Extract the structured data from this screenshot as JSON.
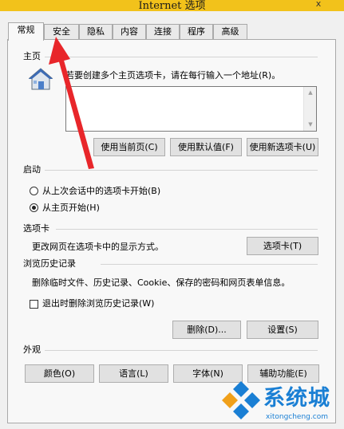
{
  "window": {
    "title": "Internet 选项",
    "close_glyph": "x"
  },
  "tabs": [
    "常规",
    "安全",
    "隐私",
    "内容",
    "连接",
    "程序",
    "高级"
  ],
  "homepage": {
    "header": "主页",
    "instruction": "若要创建多个主页选项卡，请在每行输入一个地址(R)。",
    "address_value": "",
    "buttons": {
      "use_current": "使用当前页(C)",
      "use_default": "使用默认值(F)",
      "use_new_tab": "使用新选项卡(U)"
    }
  },
  "startup": {
    "header": "启动",
    "option_last_session": "从上次会话中的选项卡开始(B)",
    "option_homepage": "从主页开始(H)",
    "selected": "homepage"
  },
  "tabs_section": {
    "header": "选项卡",
    "description": "更改网页在选项卡中的显示方式。",
    "button": "选项卡(T)"
  },
  "history": {
    "header": "浏览历史记录",
    "description": "删除临时文件、历史记录、Cookie、保存的密码和网页表单信息。",
    "checkbox_label": "退出时删除浏览历史记录(W)",
    "checkbox_checked": false,
    "delete_button": "删除(D)...",
    "settings_button": "设置(S)"
  },
  "appearance": {
    "header": "外观",
    "buttons": [
      "颜色(O)",
      "语言(L)",
      "字体(N)",
      "辅助功能(E)"
    ]
  },
  "watermark": {
    "brand": "系统城",
    "url": "xitongcheng.com"
  },
  "colors": {
    "titlebar": "#f2c21b",
    "annotation_arrow": "#e8262a",
    "watermark_blue": "#1a7fd4"
  }
}
